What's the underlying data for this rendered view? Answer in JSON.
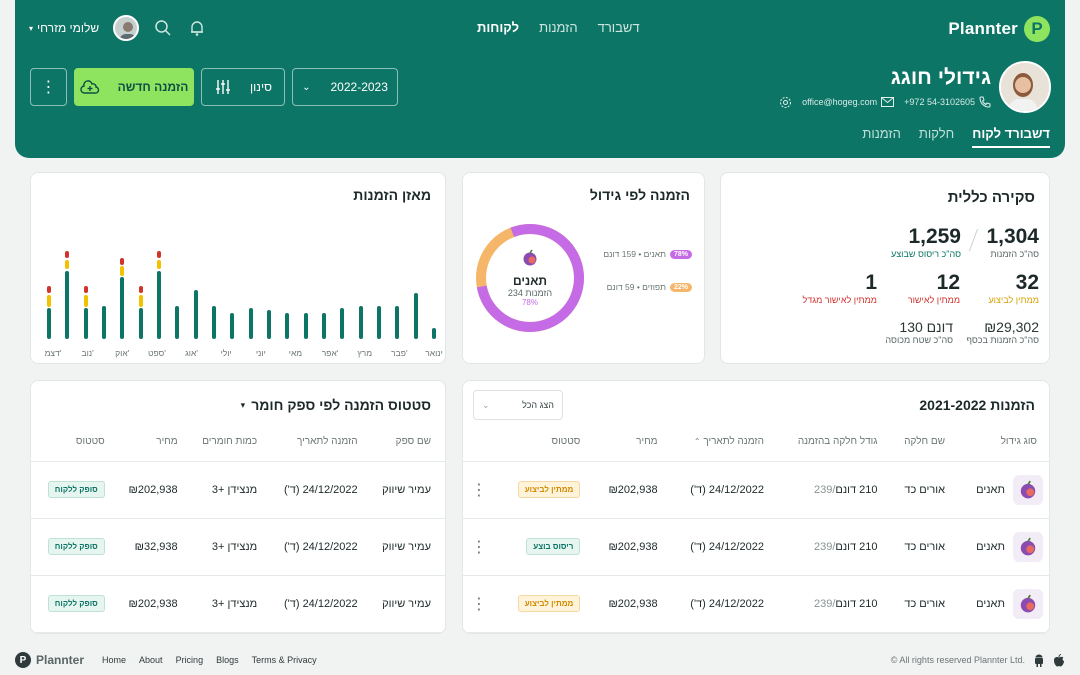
{
  "brand": {
    "name": "Plannter"
  },
  "nav": {
    "items": [
      {
        "label": "דשבורד",
        "active": false
      },
      {
        "label": "הזמנות",
        "active": false
      },
      {
        "label": "לקוחות",
        "active": true
      }
    ]
  },
  "user": {
    "name": "שלומי מזרחי"
  },
  "profile": {
    "name": "גידולי חוגג",
    "phone": "+972 54-3102605",
    "email": "office@hogeg.com"
  },
  "tabs": [
    {
      "label": "דשבורד לקוח",
      "active": true
    },
    {
      "label": "חלקות",
      "active": false
    },
    {
      "label": "הזמנות",
      "active": false
    }
  ],
  "actions": {
    "year": "2022-2023",
    "filter_label": "סינון",
    "new_order_label": "הזמנה חדשה"
  },
  "overview": {
    "title": "סקירה כללית",
    "total_orders": {
      "value": "1,304",
      "label": "סה\"כ הזמנות"
    },
    "total_executed": {
      "value": "1,259",
      "label": "סה\"כ ריסוס שבוצע"
    },
    "pending_exec": {
      "value": "32",
      "label": "ממתין לביצוע"
    },
    "pending_approval": {
      "value": "12",
      "label": "ממתין לאישור"
    },
    "pending_grower": {
      "value": "1",
      "label": "ממתין לאישור מגדל"
    },
    "total_money": {
      "value": "₪29,302",
      "label": "סה\"כ הזמנות בכסף"
    },
    "total_area": {
      "value": "130 דונם",
      "label": "סה\"כ שטח מכוסה"
    }
  },
  "by_crop": {
    "title": "הזמנה לפי גידול",
    "center_name": "תאנים",
    "center_count": "234 הזמנות",
    "center_pct": "78%",
    "legend": [
      {
        "pct": "78%",
        "text": "תאנים • 159 דונם",
        "color": "#c56be6"
      },
      {
        "pct": "22%",
        "text": "תפוזים • 59 דונם",
        "color": "#f5b66a"
      }
    ]
  },
  "balance": {
    "title": "מאזן הזמנות"
  },
  "chart_data": {
    "type": "bar",
    "title": "מאזן הזמנות",
    "categories": [
      "ינואר",
      "פברואר",
      "מרץ",
      "אפריל",
      "מאי",
      "יוני",
      "יולי",
      "אוגוסט",
      "ספטמבר",
      "אוקטובר",
      "נובמבר",
      "דצמבר"
    ],
    "category_labels": [
      "ינואר",
      "פבר'",
      "מרץ",
      "אפר'",
      "מאי",
      "יוני",
      "יולי",
      "אוג'",
      "ספט'",
      "אוק'",
      "נוב'",
      "דצמ'"
    ],
    "series": [
      {
        "color": "#0d7566",
        "values": [
          10,
          42,
          30,
          30,
          30,
          28,
          24,
          24,
          24,
          26,
          28,
          24,
          30,
          45,
          30,
          62,
          28,
          56,
          30,
          28,
          62,
          28
        ]
      },
      {
        "color": "#f2c200",
        "values": [
          0,
          0,
          0,
          0,
          0,
          0,
          0,
          0,
          0,
          0,
          0,
          0,
          0,
          0,
          0,
          10,
          12,
          10,
          0,
          12,
          10,
          12
        ]
      },
      {
        "color": "#d2332b",
        "values": [
          0,
          0,
          0,
          0,
          0,
          0,
          0,
          0,
          0,
          0,
          0,
          0,
          0,
          0,
          0,
          8,
          8,
          8,
          0,
          8,
          8,
          8
        ]
      }
    ],
    "ylim": [
      0,
      100
    ]
  },
  "orders_table": {
    "title": "הזמנות 2021-2022",
    "filter_label": "הצג הכל",
    "columns": [
      "סוג גידול",
      "שם חלקה",
      "גודל חלקה בהזמנה",
      "הזמנה לתאריך",
      "מחיר",
      "סטטוס"
    ],
    "rows": [
      {
        "crop": "תאנים",
        "plot": "אורים כד",
        "size_total": "239",
        "size_ordered": "210 דונם",
        "date": "24/12/2022 (ד')",
        "price": "₪202,938",
        "status": "ממתין לביצוע",
        "status_kind": "yellow"
      },
      {
        "crop": "תאנים",
        "plot": "אורים כד",
        "size_total": "239",
        "size_ordered": "210 דונם",
        "date": "24/12/2022 (ד')",
        "price": "₪202,938",
        "status": "ריסוס בוצע",
        "status_kind": "green"
      },
      {
        "crop": "תאנים",
        "plot": "אורים כד",
        "size_total": "239",
        "size_ordered": "210 דונם",
        "date": "24/12/2022 (ד')",
        "price": "₪202,938",
        "status": "ממתין לביצוע",
        "status_kind": "yellow"
      }
    ]
  },
  "supplier_table": {
    "title": "סטטוס הזמנה לפי ספק חומר",
    "columns": [
      "שם ספק",
      "הזמנה לתאריך",
      "כמות חומרים",
      "מחיר",
      "סטטוס"
    ],
    "rows": [
      {
        "supplier": "עמיר שיווק",
        "date": "24/12/2022 (ד')",
        "materials": "מנצידן +3",
        "price": "₪202,938",
        "status": "סופק ללקוח"
      },
      {
        "supplier": "עמיר שיווק",
        "date": "24/12/2022 (ד')",
        "materials": "מנצידן +3",
        "price": "₪32,938",
        "status": "סופק ללקוח"
      },
      {
        "supplier": "עמיר שיווק",
        "date": "24/12/2022 (ד')",
        "materials": "מנצידן +3",
        "price": "₪202,938",
        "status": "סופק ללקוח"
      }
    ]
  },
  "footer": {
    "brand": "Plannter",
    "links": [
      "Home",
      "About",
      "Pricing",
      "Blogs",
      "Terms & Privacy"
    ],
    "copyright": "© All rights reserved Plannter Ltd."
  }
}
